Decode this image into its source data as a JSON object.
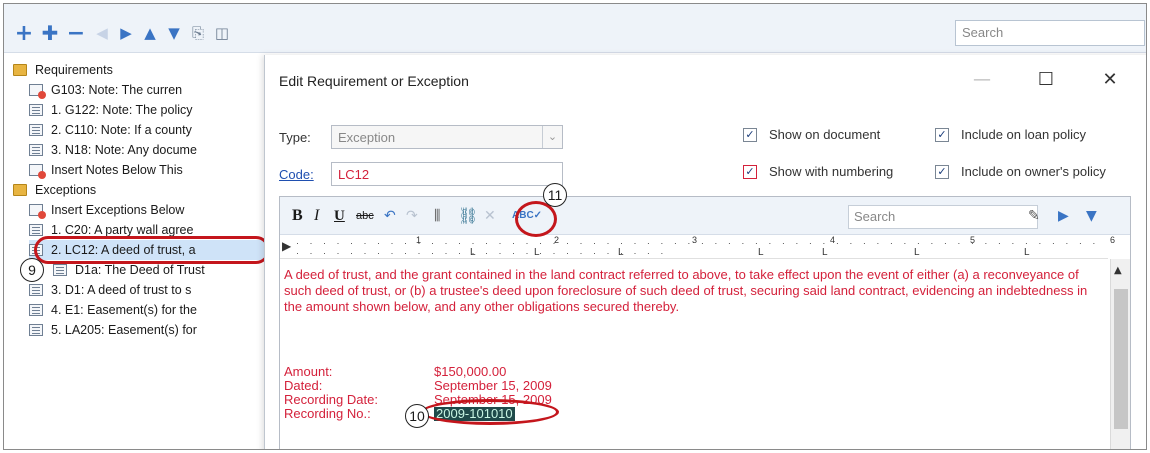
{
  "toolbar": {
    "search_placeholder": "Search",
    "icons": [
      "add-icon",
      "add-child-icon",
      "remove-icon",
      "back-icon",
      "forward-icon",
      "move-up-icon",
      "move-down-icon",
      "copy-icon",
      "panel-icon"
    ]
  },
  "tree": {
    "requirements_label": "Requirements",
    "requirements": [
      "G103: Note:  The curren",
      "1. G122: Note:  The policy",
      "2. C110: Note:  If a county",
      "3. N18: Note:  Any docume",
      "Insert Notes Below This"
    ],
    "exceptions_label": "Exceptions",
    "exceptions": [
      "Insert Exceptions Below",
      "1. C20: A party wall agree",
      "2. LC12: A deed of trust, a",
      "D1a: The Deed of Trust",
      "3. D1: A deed of trust to s",
      "4. E1: Easement(s) for the",
      "5. LA205: Easement(s) for"
    ]
  },
  "callouts": {
    "tree_item": "9",
    "recording_no": "10",
    "toolbar_button": "11"
  },
  "dialog": {
    "title": "Edit Requirement or Exception",
    "type_label": "Type:",
    "type_value": "Exception",
    "code_label": "Code:",
    "code_value": "LC12",
    "show_on_document": "Show on document",
    "show_with_numbering": "Show with numbering",
    "include_loan_policy": "Include on loan policy",
    "include_owners_policy": "Include on owner's policy",
    "check_mark": "✓",
    "editor_search_placeholder": "Search",
    "ruler_marks": [
      "1",
      "2",
      "3",
      "4",
      "5",
      "6"
    ],
    "body": "A deed of trust, and the grant contained in the land contract referred to above, to take effect upon the event of either (a) a reconveyance of such deed of trust, or (b) a trustee's deed upon foreclosure of such deed of trust, securing said land contract, evidencing an indebtedness in the amount shown below, and any other obligations secured thereby.",
    "details": {
      "amount_label": "Amount:",
      "amount_value": "$150,000.00",
      "dated_label": "Dated:",
      "dated_value": "September 15, 2009",
      "recording_date_label": "Recording Date:",
      "recording_date_value": "September 15, 2009",
      "recording_no_label": "Recording No.:",
      "recording_no_value": "2009-101010"
    }
  },
  "colors": {
    "accent_red": "#c4161c",
    "body_text": "#d4213b"
  }
}
